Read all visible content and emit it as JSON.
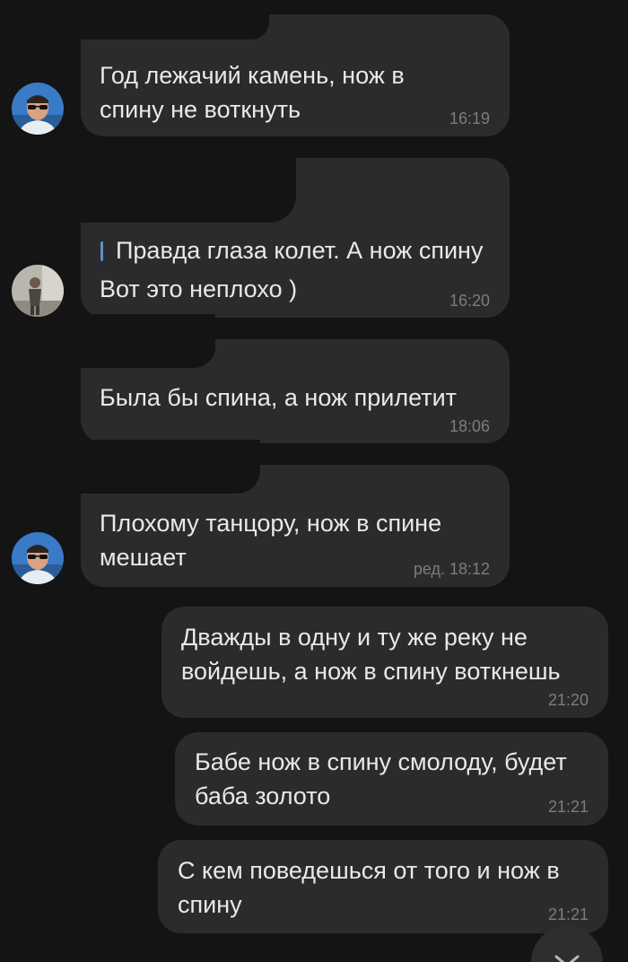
{
  "messages": [
    {
      "side": "incoming",
      "avatar": "man-sunglasses-avatar",
      "text": "Год лежачий камень, нож в\nспину не воткнуть",
      "time": "16:19"
    },
    {
      "side": "incoming",
      "avatar": "man-gray-avatar",
      "quote": "Правда глаза колет. А нож спину",
      "text": "Вот это неплохо )",
      "time": "16:20"
    },
    {
      "side": "incoming",
      "avatar": null,
      "text": "Была бы спина, а нож прилетит",
      "time": "18:06"
    },
    {
      "side": "incoming",
      "avatar": "man-sunglasses-avatar",
      "text": "Плохому танцору, нож в спине\nмешает",
      "time": "ред. 18:12"
    },
    {
      "side": "outgoing",
      "text": "Дважды в одну и ту же реку не\nвойдешь, а нож в спину воткнешь",
      "time": "21:20"
    },
    {
      "side": "outgoing",
      "text": "Бабе нож в спину смолоду, будет\nбаба золото",
      "time": "21:21"
    },
    {
      "side": "outgoing",
      "text": "С кем поведешься от того и нож в\nспину",
      "time": "21:21"
    }
  ],
  "scroll_button": {
    "icon": "chevron-down-icon"
  },
  "colors": {
    "background": "#141414",
    "bubble": "#2b2b2d",
    "text": "#e9e9ea",
    "time": "#7d7d80",
    "quote_bar": "#5b8ec9"
  }
}
